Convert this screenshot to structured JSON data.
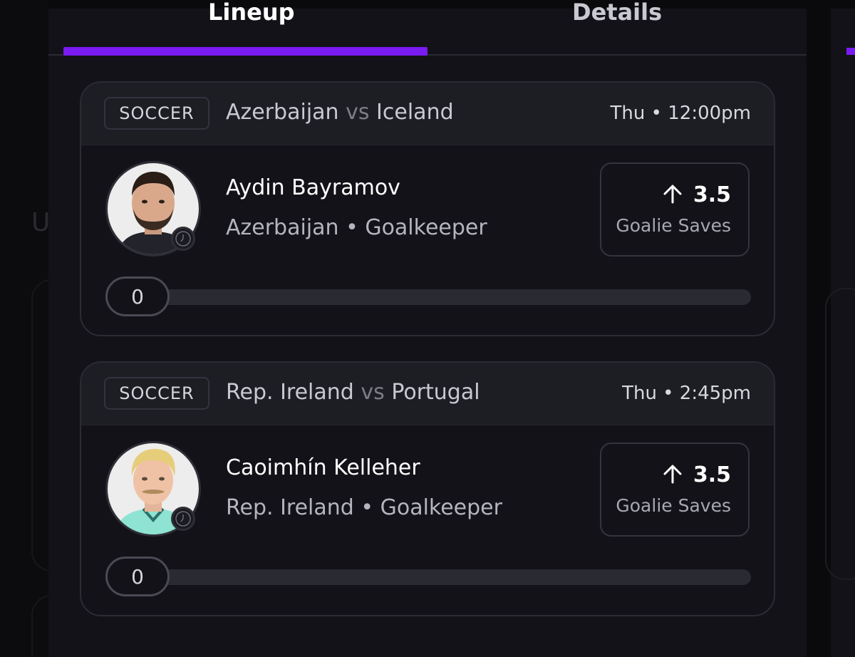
{
  "tabs": [
    {
      "label": "Lineup",
      "active": true
    },
    {
      "label": "Details",
      "active": false
    }
  ],
  "accent_color": "#7a1bf2",
  "picks": [
    {
      "sport": "SOCCER",
      "team_a": "Azerbaijan",
      "vs": "vs",
      "team_b": "Iceland",
      "day": "Thu",
      "time": "12:00pm",
      "time_label": "Thu • 12:00pm",
      "player_name": "Aydin Bayramov",
      "player_meta": "Azerbaijan • Goalkeeper",
      "direction_icon": "arrow-up-icon",
      "line": "3.5",
      "stat": "Goalie Saves",
      "progress": "0"
    },
    {
      "sport": "SOCCER",
      "team_a": "Rep. Ireland",
      "vs": "vs",
      "team_b": "Portugal",
      "day": "Thu",
      "time": "2:45pm",
      "time_label": "Thu • 2:45pm",
      "player_name": "Caoimhín Kelleher",
      "player_meta": "Rep. Ireland • Goalkeeper",
      "direction_icon": "arrow-up-icon",
      "line": "3.5",
      "stat": "Goalie Saves",
      "progress": "0"
    }
  ]
}
